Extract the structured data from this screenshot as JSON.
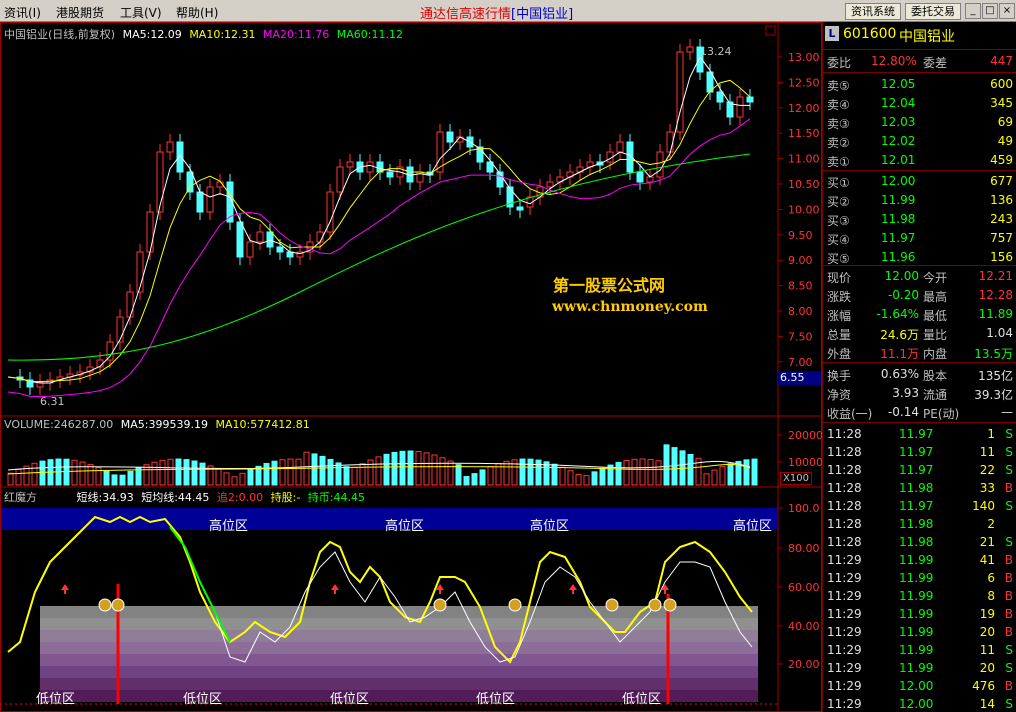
{
  "menu": {
    "items": [
      "资讯(I)",
      "港股期货",
      "工具(V)",
      "帮助(H)"
    ],
    "title": "通达信高速行情",
    "title_stock": "[中国铝业]",
    "btn_info": "资讯系统",
    "btn_trade": "委托交易",
    "win_min": "_",
    "win_max": "□",
    "win_close": "×"
  },
  "price_pane": {
    "title": "中国铝业(日线,前复权)",
    "ma5": "MA5:12.09",
    "ma10": "MA10:12.31",
    "ma20": "MA20:11.76",
    "ma60": "MA60:11.12",
    "high_label": "13.24",
    "low_label": "6.31",
    "current_tag": "6.55",
    "watermark_cn": "第一股票公式网",
    "watermark_url": "www.chnmoney.com",
    "y_labels": [
      "13.00",
      "12.50",
      "12.00",
      "11.50",
      "11.00",
      "10.50",
      "10.00",
      "9.50",
      "9.00",
      "8.50",
      "8.00",
      "7.50",
      "7.00"
    ],
    "colors": {
      "up": "#ff3333",
      "down": "#54ffff",
      "ma5": "#ffffff",
      "ma10": "#ffff00",
      "ma20": "#ff00ff",
      "ma60": "#00ff00"
    }
  },
  "volume_pane": {
    "volume": "VOLUME:246287.00",
    "ma5": "MA5:399539.19",
    "ma10": "MA10:577412.81",
    "y_labels": [
      "20000",
      "10000"
    ],
    "unit": "X100"
  },
  "indicator_pane": {
    "name": "红魔方",
    "short": "短线:34.93",
    "short_avg": "短均线:44.45",
    "chase": "追2:0.00",
    "hold_label": "持股:-",
    "hold_coin": "持币:44.45",
    "high_zone": "高位区",
    "low_zone": "低位区",
    "y_labels": [
      "100.0",
      "80.00",
      "60.00",
      "40.00",
      "20.00"
    ]
  },
  "quote": {
    "code": "601600",
    "name": "中国铝业",
    "weibi_label": "委比",
    "weibi_value": "12.80%",
    "weicha_label": "委差",
    "weicha_value": "447",
    "sell": [
      {
        "label": "卖⑤",
        "price": "12.05",
        "vol": "600"
      },
      {
        "label": "卖④",
        "price": "12.04",
        "vol": "345"
      },
      {
        "label": "卖③",
        "price": "12.03",
        "vol": "69"
      },
      {
        "label": "卖②",
        "price": "12.02",
        "vol": "49"
      },
      {
        "label": "卖①",
        "price": "12.01",
        "vol": "459"
      }
    ],
    "buy": [
      {
        "label": "买①",
        "price": "12.00",
        "vol": "677"
      },
      {
        "label": "买②",
        "price": "11.99",
        "vol": "136"
      },
      {
        "label": "买③",
        "price": "11.98",
        "vol": "243"
      },
      {
        "label": "买④",
        "price": "11.97",
        "vol": "757"
      },
      {
        "label": "买⑤",
        "price": "11.96",
        "vol": "156"
      }
    ],
    "stats": [
      {
        "l1": "现价",
        "v1": "12.00",
        "c1": "grn",
        "l2": "今开",
        "v2": "12.21",
        "c2": "red"
      },
      {
        "l1": "涨跌",
        "v1": "-0.20",
        "c1": "grn",
        "l2": "最高",
        "v2": "12.28",
        "c2": "red"
      },
      {
        "l1": "涨幅",
        "v1": "-1.64%",
        "c1": "grn",
        "l2": "最低",
        "v2": "11.89",
        "c2": "grn"
      },
      {
        "l1": "总量",
        "v1": "24.6万",
        "c1": "yel",
        "l2": "量比",
        "v2": "1.04",
        "c2": "wht"
      },
      {
        "l1": "外盘",
        "v1": "11.1万",
        "c1": "red",
        "l2": "内盘",
        "v2": "13.5万",
        "c2": "grn"
      }
    ],
    "fund": [
      {
        "l1": "换手",
        "v1": "0.63%",
        "l2": "股本",
        "v2": "135亿"
      },
      {
        "l1": "净资",
        "v1": "3.93",
        "l2": "流通",
        "v2": "39.3亿"
      },
      {
        "l1": "收益(一)",
        "v1": "-0.14",
        "l2": "PE(动)",
        "v2": "—"
      }
    ],
    "ticks": [
      {
        "t": "11:28",
        "p": "11.97",
        "v": "1",
        "s": "S"
      },
      {
        "t": "11:28",
        "p": "11.97",
        "v": "11",
        "s": "S"
      },
      {
        "t": "11:28",
        "p": "11.97",
        "v": "22",
        "s": "S"
      },
      {
        "t": "11:28",
        "p": "11.98",
        "v": "33",
        "s": "B"
      },
      {
        "t": "11:28",
        "p": "11.97",
        "v": "140",
        "s": "S"
      },
      {
        "t": "11:28",
        "p": "11.98",
        "v": "2",
        "s": ""
      },
      {
        "t": "11:28",
        "p": "11.98",
        "v": "21",
        "s": "S"
      },
      {
        "t": "11:29",
        "p": "11.99",
        "v": "41",
        "s": "B"
      },
      {
        "t": "11:29",
        "p": "11.99",
        "v": "6",
        "s": "B"
      },
      {
        "t": "11:29",
        "p": "11.99",
        "v": "8",
        "s": "B"
      },
      {
        "t": "11:29",
        "p": "11.99",
        "v": "19",
        "s": "B"
      },
      {
        "t": "11:29",
        "p": "11.99",
        "v": "20",
        "s": "B"
      },
      {
        "t": "11:29",
        "p": "11.99",
        "v": "11",
        "s": "S"
      },
      {
        "t": "11:29",
        "p": "11.99",
        "v": "20",
        "s": "S"
      },
      {
        "t": "11:29",
        "p": "12.00",
        "v": "476",
        "s": "B"
      },
      {
        "t": "11:29",
        "p": "12.00",
        "v": "14",
        "s": "S"
      }
    ]
  }
}
